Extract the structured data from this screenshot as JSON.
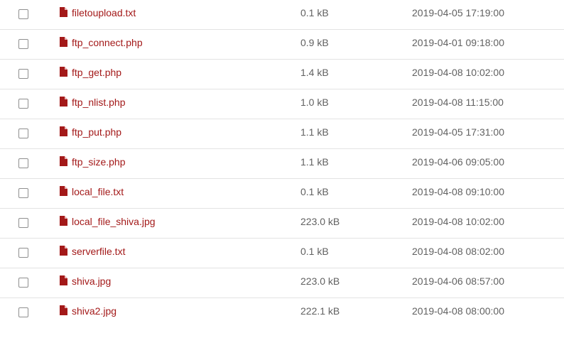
{
  "icon": "file-icon",
  "colors": {
    "link": "#a31919",
    "icon": "#a31919",
    "meta_text": "#616161",
    "row_divider": "#e3e3e3"
  },
  "files": [
    {
      "name": "filetoupload.txt",
      "size": "0.1 kB",
      "modified": "2019-04-05 17:19:00"
    },
    {
      "name": "ftp_connect.php",
      "size": "0.9 kB",
      "modified": "2019-04-01 09:18:00"
    },
    {
      "name": "ftp_get.php",
      "size": "1.4 kB",
      "modified": "2019-04-08 10:02:00"
    },
    {
      "name": "ftp_nlist.php",
      "size": "1.0 kB",
      "modified": "2019-04-08 11:15:00"
    },
    {
      "name": "ftp_put.php",
      "size": "1.1 kB",
      "modified": "2019-04-05 17:31:00"
    },
    {
      "name": "ftp_size.php",
      "size": "1.1 kB",
      "modified": "2019-04-06 09:05:00"
    },
    {
      "name": "local_file.txt",
      "size": "0.1 kB",
      "modified": "2019-04-08 09:10:00"
    },
    {
      "name": "local_file_shiva.jpg",
      "size": "223.0 kB",
      "modified": "2019-04-08 10:02:00"
    },
    {
      "name": "serverfile.txt",
      "size": "0.1 kB",
      "modified": "2019-04-08 08:02:00"
    },
    {
      "name": "shiva.jpg",
      "size": "223.0 kB",
      "modified": "2019-04-06 08:57:00"
    },
    {
      "name": "shiva2.jpg",
      "size": "222.1 kB",
      "modified": "2019-04-08 08:00:00"
    }
  ]
}
